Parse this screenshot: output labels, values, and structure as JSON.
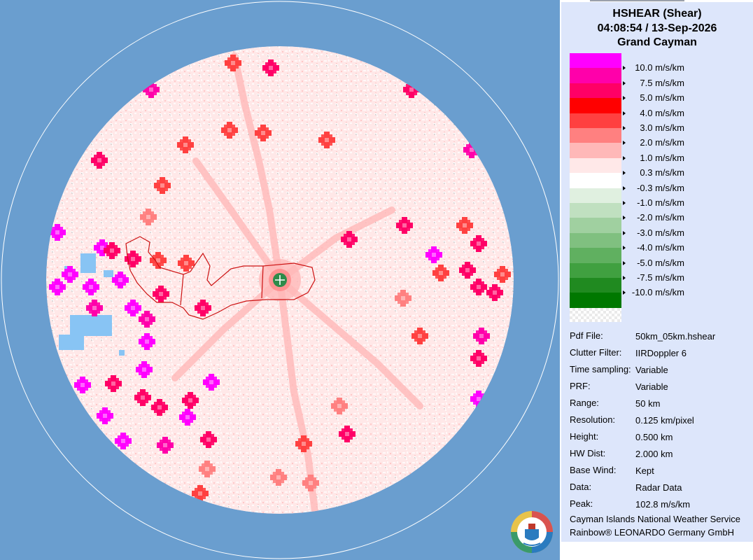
{
  "header": {
    "title": "HSHEAR (Shear)",
    "datetime": "04:08:54 / 13-Sep-2026",
    "location": "Grand Cayman"
  },
  "legend": [
    {
      "label": "10.0 m/s/km",
      "color": "#ff00ff"
    },
    {
      "label": "7.5 m/s/km",
      "color": "#ff00aa"
    },
    {
      "label": "5.0 m/s/km",
      "color": "#ff0066"
    },
    {
      "label": "4.0 m/s/km",
      "color": "#ff0000"
    },
    {
      "label": "3.0 m/s/km",
      "color": "#ff4040"
    },
    {
      "label": "2.0 m/s/km",
      "color": "#ff8080"
    },
    {
      "label": "1.0 m/s/km",
      "color": "#ffb8b8"
    },
    {
      "label": "0.3 m/s/km",
      "color": "#ffe8e8"
    },
    {
      "label": "-0.3 m/s/km",
      "color": "#ffffff"
    },
    {
      "label": "-1.0 m/s/km",
      "color": "#e0f0e0"
    },
    {
      "label": "-2.0 m/s/km",
      "color": "#c0e0c0"
    },
    {
      "label": "-3.0 m/s/km",
      "color": "#a0d0a0"
    },
    {
      "label": "-4.0 m/s/km",
      "color": "#80c080"
    },
    {
      "label": "-5.0 m/s/km",
      "color": "#60b060"
    },
    {
      "label": "-7.5 m/s/km",
      "color": "#40a040"
    },
    {
      "label": "-10.0 m/s/km",
      "color": "#208a20"
    },
    {
      "label": "",
      "color": "#007800"
    }
  ],
  "info": [
    {
      "label": "Pdf File:",
      "value": "50km_05km.hshear"
    },
    {
      "label": "Clutter Filter:",
      "value": "IIRDoppler 6"
    },
    {
      "label": "Time sampling:",
      "value": "Variable"
    },
    {
      "label": "PRF:",
      "value": "Variable"
    },
    {
      "label": "Range:",
      "value": "50 km"
    },
    {
      "label": "Resolution:",
      "value": "0.125 km/pixel"
    },
    {
      "label": "Height:",
      "value": "0.500 km"
    },
    {
      "label": "HW Dist:",
      "value": "2.000 km"
    },
    {
      "label": "Base Wind:",
      "value": "Kept"
    },
    {
      "label": "Data:",
      "value": "Radar Data"
    },
    {
      "label": "Peak:",
      "value": "102.8 m/s/km"
    }
  ],
  "credits": {
    "service": "Cayman Islands National Weather Service",
    "vendor": "Rainbow® LEONARDO Germany GmbH"
  },
  "colors": {
    "sea": "#6a9ecf",
    "panel": "#dde6fb",
    "radar_background": "#ffe8e8",
    "clutter_blue": "#88c4f4",
    "site_marker": "#2e8b4a",
    "coastline": "#cc0000"
  },
  "icons": {
    "radar_site": "plus-in-circle",
    "logo": "nws-seal"
  }
}
